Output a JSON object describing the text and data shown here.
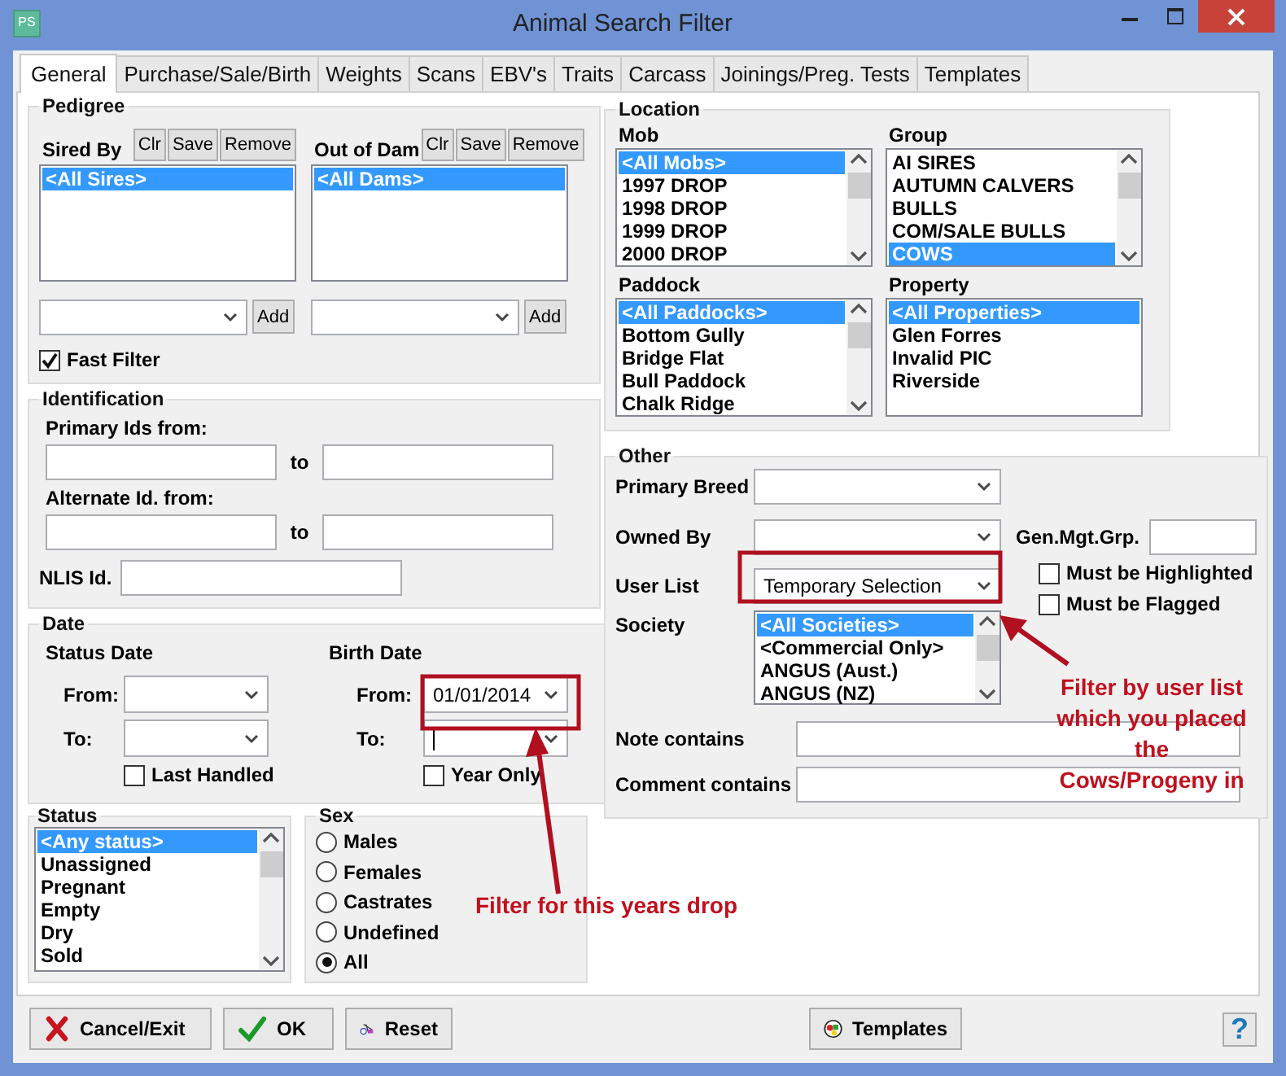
{
  "window": {
    "title": "Animal Search Filter",
    "app_icon_text": "PS"
  },
  "tabs": [
    {
      "label": "General",
      "selected": true
    },
    {
      "label": "Purchase/Sale/Birth",
      "selected": false
    },
    {
      "label": "Weights",
      "selected": false
    },
    {
      "label": "Scans",
      "selected": false
    },
    {
      "label": "EBV's",
      "selected": false
    },
    {
      "label": "Traits",
      "selected": false
    },
    {
      "label": "Carcass",
      "selected": false
    },
    {
      "label": "Joinings/Preg. Tests",
      "selected": false
    },
    {
      "label": "Templates",
      "selected": false
    }
  ],
  "pedigree": {
    "title": "Pedigree",
    "pickers": [
      {
        "label": "Sired By",
        "buttons": [
          "Clr",
          "Save",
          "Remove"
        ],
        "items": [
          {
            "text": "<All Sires>",
            "selected": true
          }
        ],
        "add_button": "Add"
      },
      {
        "label": "Out of Dam",
        "buttons": [
          "Clr",
          "Save",
          "Remove"
        ],
        "items": [
          {
            "text": "<All Dams>",
            "selected": true
          }
        ],
        "add_button": "Add"
      }
    ],
    "fast_filter": {
      "label": "Fast Filter",
      "checked": true
    }
  },
  "identification": {
    "title": "Identification",
    "ranges": [
      {
        "label": "Primary Ids from:",
        "to": "to"
      },
      {
        "label": "Alternate Id. from:",
        "to": "to"
      }
    ],
    "nlis_label": "NLIS Id."
  },
  "date": {
    "title": "Date",
    "groups": [
      {
        "label": "Status Date",
        "from_label": "From:",
        "to_label": "To:",
        "text_cursor": false,
        "checkbox": {
          "label": "Last Handled",
          "checked": false
        }
      },
      {
        "label": "Birth Date",
        "from_label": "From:",
        "from_value": "01/01/2014",
        "to_label": "To:",
        "text_cursor": true,
        "checkbox": {
          "label": "Year Only",
          "checked": false
        }
      }
    ]
  },
  "status": {
    "title": "Status",
    "scrollbar": true,
    "items": [
      {
        "text": "<Any status>",
        "selected": true
      },
      {
        "text": "Unassigned",
        "selected": false
      },
      {
        "text": "Pregnant",
        "selected": false
      },
      {
        "text": "Empty",
        "selected": false
      },
      {
        "text": "Dry",
        "selected": false
      },
      {
        "text": "Sold",
        "selected": false
      }
    ]
  },
  "sex": {
    "title": "Sex",
    "options": [
      {
        "label": "Males",
        "selected": false
      },
      {
        "label": "Females",
        "selected": false
      },
      {
        "label": "Castrates",
        "selected": false
      },
      {
        "label": "Undefined",
        "selected": false
      },
      {
        "label": "All",
        "selected": true
      }
    ]
  },
  "location": {
    "title": "Location",
    "lists": [
      {
        "label": "Mob",
        "scrollbar": true,
        "items": [
          {
            "text": "<All Mobs>",
            "selected": true
          },
          {
            "text": "1997 DROP",
            "selected": false
          },
          {
            "text": "1998 DROP",
            "selected": false
          },
          {
            "text": "1999 DROP",
            "selected": false
          },
          {
            "text": "2000 DROP",
            "selected": false
          }
        ]
      },
      {
        "label": "Group",
        "scrollbar": true,
        "items": [
          {
            "text": "AI SIRES",
            "selected": false
          },
          {
            "text": "AUTUMN CALVERS",
            "selected": false
          },
          {
            "text": "BULLS",
            "selected": false
          },
          {
            "text": "COM/SALE BULLS",
            "selected": false
          },
          {
            "text": "COWS",
            "selected": true
          }
        ]
      },
      {
        "label": "Paddock",
        "scrollbar": true,
        "items": [
          {
            "text": "<All Paddocks>",
            "selected": true
          },
          {
            "text": "Bottom Gully",
            "selected": false
          },
          {
            "text": "Bridge Flat",
            "selected": false
          },
          {
            "text": "Bull Paddock",
            "selected": false
          },
          {
            "text": "Chalk Ridge",
            "selected": false
          }
        ]
      },
      {
        "label": "Property",
        "scrollbar": false,
        "items": [
          {
            "text": "<All Properties>",
            "selected": true
          },
          {
            "text": "Glen Forres",
            "selected": false
          },
          {
            "text": "Invalid PIC",
            "selected": false
          },
          {
            "text": "Riverside",
            "selected": false
          }
        ]
      }
    ]
  },
  "other": {
    "title": "Other",
    "primary_breed": {
      "label": "Primary Breed"
    },
    "owned_by": {
      "label": "Owned By"
    },
    "gen_mgt_grp": {
      "label": "Gen.Mgt.Grp."
    },
    "user_list": {
      "label": "User List",
      "value": "Temporary Selection"
    },
    "flags": [
      {
        "label": "Must be Highlighted",
        "checked": false
      },
      {
        "label": "Must be Flagged",
        "checked": false
      }
    ],
    "society": {
      "label": "Society",
      "scrollbar": true,
      "items": [
        {
          "text": "<All Societies>",
          "selected": true
        },
        {
          "text": "<Commercial Only>",
          "selected": false
        },
        {
          "text": "ANGUS (Aust.)",
          "selected": false
        },
        {
          "text": "ANGUS (NZ)",
          "selected": false
        }
      ]
    },
    "text_filters": [
      {
        "label": "Note contains"
      },
      {
        "label": "Comment contains"
      }
    ]
  },
  "annotations": [
    {
      "kind": "user-list",
      "text": "Filter by user list\nwhich you placed\nthe\nCows/Progeny in"
    },
    {
      "kind": "birth-date",
      "text": "Filter for this years drop"
    }
  ],
  "buttons": [
    {
      "label": "Cancel/Exit",
      "kind": "cancel"
    },
    {
      "label": "OK",
      "kind": "ok"
    },
    {
      "label": "Reset",
      "kind": "reset"
    },
    {
      "label": "Templates",
      "kind": "templates"
    },
    {
      "label": "?",
      "kind": "help"
    }
  ]
}
